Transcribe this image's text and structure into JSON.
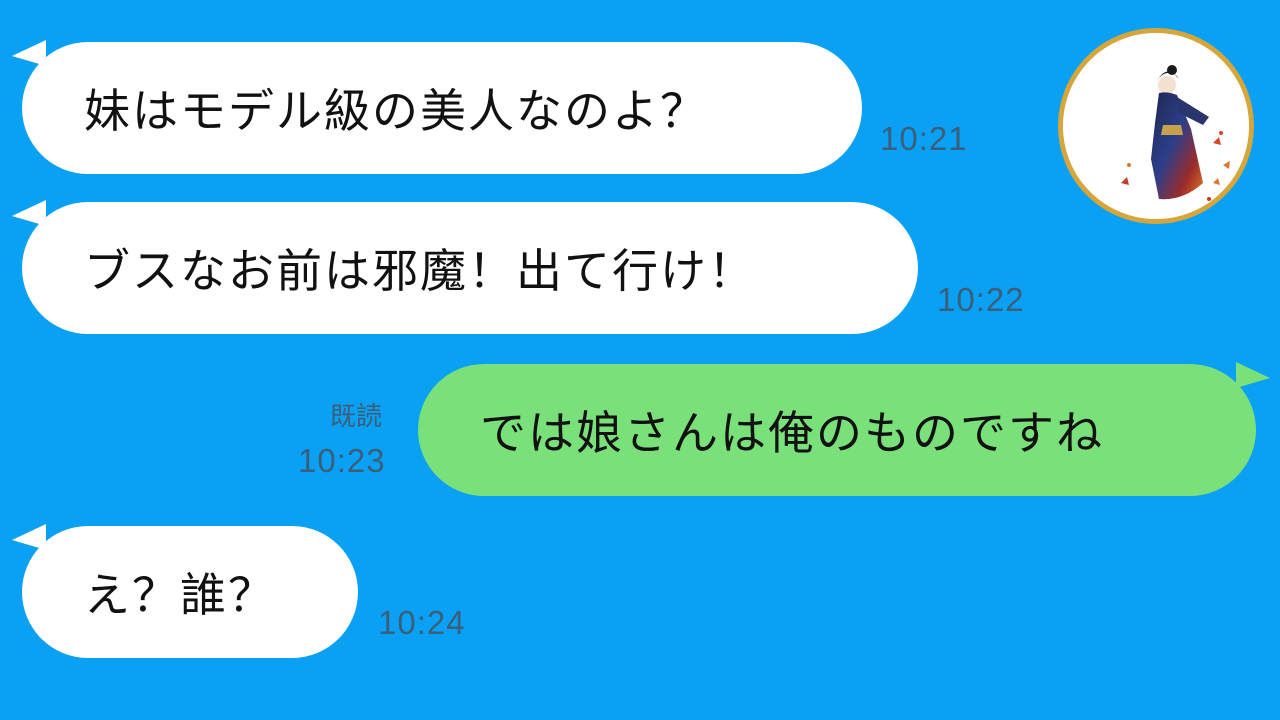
{
  "chat": {
    "messages": [
      {
        "side": "in",
        "text": "妹はモデル級の美人なのよ？",
        "time": "10:21"
      },
      {
        "side": "in",
        "text": "ブスなお前は邪魔！出て行け！",
        "time": "10:22"
      },
      {
        "side": "out",
        "text": "では娘さんは俺のものですね",
        "time": "10:23",
        "read": "既読"
      },
      {
        "side": "in",
        "text": "え？誰？",
        "time": "10:24"
      }
    ]
  },
  "colors": {
    "background": "#0aa0f4",
    "incoming_bubble": "#ffffff",
    "outgoing_bubble": "#79e07a",
    "timestamp": "#3a5f7a",
    "avatar_ring": "#d6a63a"
  },
  "avatar": {
    "icon": "crescent-moon-kimono-woman-avatar"
  }
}
